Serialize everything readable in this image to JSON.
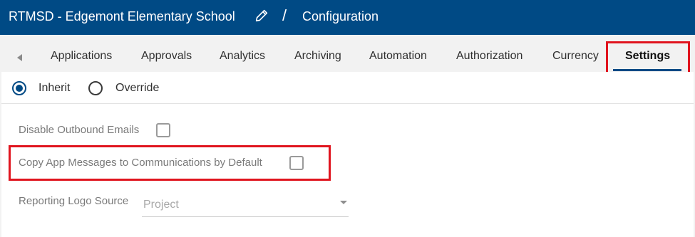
{
  "header": {
    "project_name": "RTMSD - Edgemont Elementary School",
    "separator": "/",
    "breadcrumb": "Configuration",
    "edit_icon": "pencil-icon",
    "background_color": "#004a85"
  },
  "tabs": {
    "scroll_icon": "caret-left-icon",
    "items": [
      {
        "label": "Applications"
      },
      {
        "label": "Approvals"
      },
      {
        "label": "Analytics"
      },
      {
        "label": "Archiving"
      },
      {
        "label": "Automation"
      },
      {
        "label": "Authorization"
      },
      {
        "label": "Currency"
      },
      {
        "label": "Settings",
        "active": true
      }
    ]
  },
  "mode": {
    "inherit_label": "Inherit",
    "override_label": "Override",
    "selected": "Inherit"
  },
  "settings": {
    "disable_outbound_emails": {
      "label": "Disable Outbound Emails",
      "checked": false
    },
    "copy_app_messages": {
      "label": "Copy App Messages to Communications by Default",
      "checked": false
    },
    "reporting_logo_source": {
      "label": "Reporting Logo Source",
      "value": "Project"
    }
  },
  "highlight_color": "#e0141e"
}
